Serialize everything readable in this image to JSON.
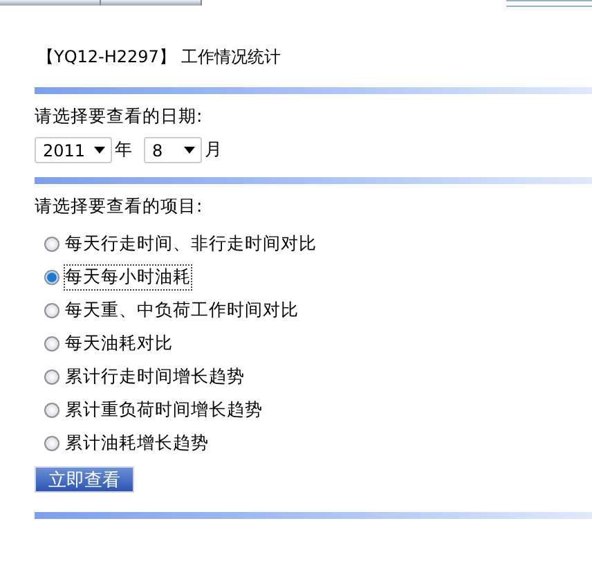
{
  "title": "【YQ12-H2297】 工作情况统计",
  "date_section": {
    "label": "请选择要查看的日期:",
    "year": {
      "value": "2011",
      "unit": "年"
    },
    "month": {
      "value": "8",
      "unit": "月"
    }
  },
  "items_section": {
    "label": "请选择要查看的项目:",
    "options": [
      {
        "label": "每天行走时间、非行走时间对比",
        "selected": false
      },
      {
        "label": "每天每小时油耗",
        "selected": true
      },
      {
        "label": "每天重、中负荷工作时间对比",
        "selected": false
      },
      {
        "label": "每天油耗对比",
        "selected": false
      },
      {
        "label": "累计行走时间增长趋势",
        "selected": false
      },
      {
        "label": "累计重负荷时间增长趋势",
        "selected": false
      },
      {
        "label": "累计油耗增长趋势",
        "selected": false
      }
    ]
  },
  "button": "立即查看"
}
